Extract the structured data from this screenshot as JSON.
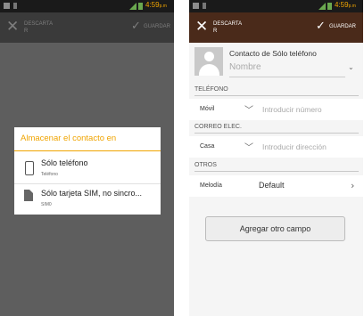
{
  "status": {
    "time": "4:59",
    "ampm": "p.m"
  },
  "action_bar": {
    "discard_label": "DESCARTA\nR",
    "save_label": "GUARDAR"
  },
  "left_screen": {
    "dialog": {
      "title": "Almacenar el contacto en",
      "options": [
        {
          "label": "Sólo teléfono",
          "sublabel": "Teléfono",
          "icon": "phone-icon"
        },
        {
          "label": "Sólo tarjeta SIM, no sincro...",
          "sublabel": "SIM0",
          "icon": "sim-card-icon"
        }
      ]
    }
  },
  "right_screen": {
    "account_label": "Contacto de Sólo teléfono",
    "name_placeholder": "Nombre",
    "sections": {
      "phone": "TELÉFONO",
      "email": "CORREO ELEC.",
      "others": "OTROS"
    },
    "phone_row": {
      "type": "Móvil",
      "placeholder": "Introducir número"
    },
    "email_row": {
      "type": "Casa",
      "placeholder": "Introducir dirección"
    },
    "ringtone_row": {
      "label": "Melodía",
      "value": "Default"
    },
    "add_field_button": "Agregar otro campo"
  }
}
